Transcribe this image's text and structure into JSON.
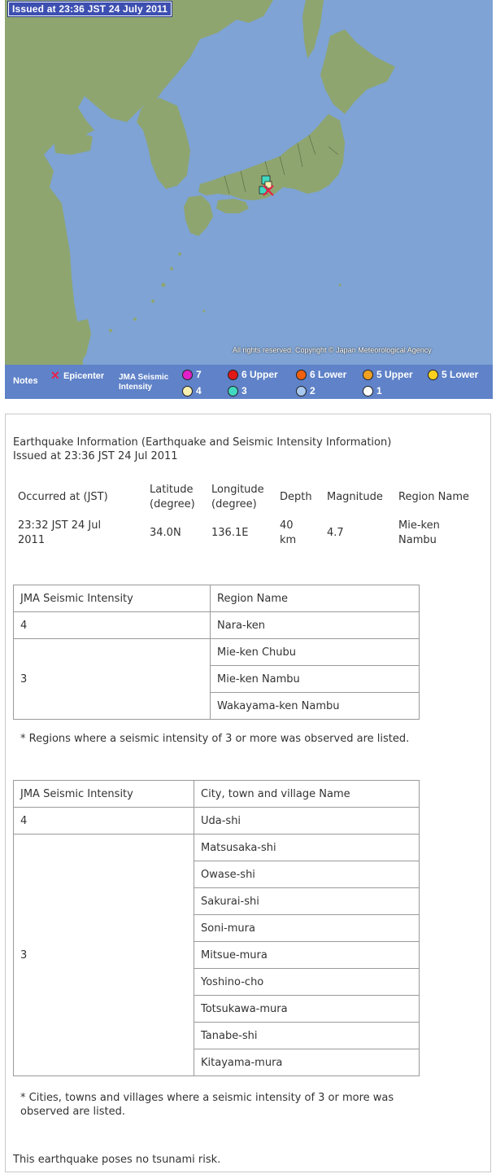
{
  "map": {
    "issued": "Issued at 23:36 JST  24 July 2011",
    "copyright": "All rights reserved. Copyright © Japan Meteorological Agency",
    "legend": {
      "notes_label": "Notes",
      "epicenter_label": "Epicenter",
      "jma_label_line1": "JMA Seismic",
      "jma_label_line2": "Intensity",
      "items": [
        {
          "label": "7",
          "color": "#e020c8"
        },
        {
          "label": "6 Upper",
          "color": "#e01818"
        },
        {
          "label": "6 Lower",
          "color": "#f06010"
        },
        {
          "label": "5 Upper",
          "color": "#f0a020"
        },
        {
          "label": "5 Lower",
          "color": "#f8d020"
        },
        {
          "label": "4",
          "color": "#f8f0b0"
        },
        {
          "label": "3",
          "color": "#40d8c0"
        },
        {
          "label": "2",
          "color": "#a8c8f0"
        },
        {
          "label": "1",
          "color": "#ffffff"
        }
      ]
    },
    "colors": {
      "sea": "#7ea3d4",
      "land": "#8fa56f",
      "mountain": "#6f8250"
    }
  },
  "info": {
    "title_line1": "Earthquake Information (Earthquake and Seismic Intensity Information)",
    "title_line2": "Issued at 23:36 JST 24 Jul 2011",
    "summary": {
      "headers": {
        "occurred": "Occurred at (JST)",
        "lat_1": "Latitude",
        "lat_2": "(degree)",
        "lon_1": "Longitude",
        "lon_2": "(degree)",
        "depth": "Depth",
        "magnitude": "Magnitude",
        "region": "Region Name"
      },
      "values": {
        "occurred_1": "23:32 JST 24 Jul",
        "occurred_2": "2011",
        "latitude": "34.0N",
        "longitude": "136.1E",
        "depth_1": "40",
        "depth_2": "km",
        "magnitude": "4.7",
        "region_1": "Mie-ken",
        "region_2": "Nambu"
      }
    },
    "region_table": {
      "col1": "JMA Seismic Intensity",
      "col2": "Region Name",
      "rows": [
        {
          "intensity": "4",
          "names": [
            "Nara-ken"
          ]
        },
        {
          "intensity": "3",
          "names": [
            "Mie-ken Chubu",
            "Mie-ken Nambu",
            "Wakayama-ken Nambu"
          ]
        }
      ],
      "note": "* Regions where a seismic intensity of 3 or more was observed are listed."
    },
    "city_table": {
      "col1": "JMA Seismic Intensity",
      "col2": "City, town and village Name",
      "rows": [
        {
          "intensity": "4",
          "names": [
            "Uda-shi"
          ]
        },
        {
          "intensity": "3",
          "names": [
            "Matsusaka-shi",
            "Owase-shi",
            "Sakurai-shi",
            "Soni-mura",
            "Mitsue-mura",
            "Yoshino-cho",
            "Totsukawa-mura",
            "Tanabe-shi",
            "Kitayama-mura"
          ]
        }
      ],
      "note_line1": "* Cities, towns and villages where a seismic intensity of 3 or more was",
      "note_line2": "observed are listed."
    },
    "tsunami": "This earthquake poses no tsunami risk."
  }
}
